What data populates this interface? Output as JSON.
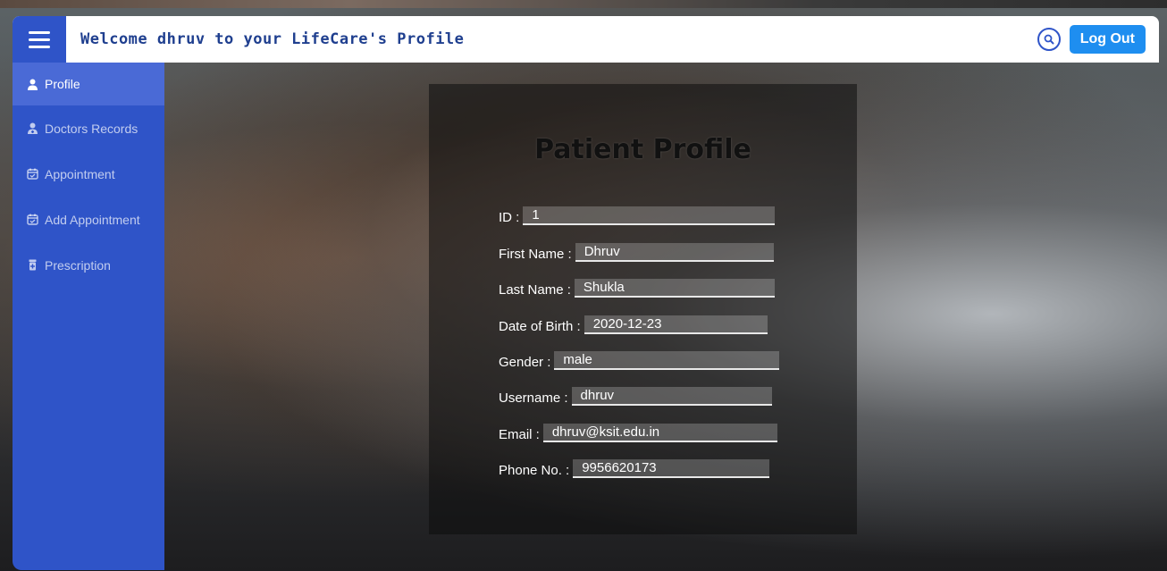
{
  "header": {
    "title": "Welcome dhruv to your LifeCare's Profile",
    "logout_label": "Log Out"
  },
  "sidebar": {
    "items": [
      {
        "label": "Profile",
        "icon": "user-icon",
        "active": true
      },
      {
        "label": "Doctors Records",
        "icon": "doctor-icon",
        "active": false
      },
      {
        "label": "Appointment",
        "icon": "calendar-check-icon",
        "active": false
      },
      {
        "label": "Add Appointment",
        "icon": "calendar-check-icon",
        "active": false
      },
      {
        "label": "Prescription",
        "icon": "prescription-bottle-icon",
        "active": false
      }
    ]
  },
  "profile": {
    "title": "Patient Profile",
    "fields": [
      {
        "label": "ID :",
        "value": "1"
      },
      {
        "label": "First Name :",
        "value": "Dhruv"
      },
      {
        "label": "Last Name :",
        "value": "Shukla"
      },
      {
        "label": "Date of Birth :",
        "value": "2020-12-23"
      },
      {
        "label": "Gender :",
        "value": "male"
      },
      {
        "label": "Username :",
        "value": "dhruv"
      },
      {
        "label": "Email :",
        "value": "dhruv@ksit.edu.in"
      },
      {
        "label": "Phone No. :",
        "value": "9956620173"
      }
    ]
  },
  "colors": {
    "accent": "#2f54c8",
    "active_item": "#4a6ad6",
    "logout": "#1e8ef0",
    "title_text": "#1f3f8f"
  }
}
